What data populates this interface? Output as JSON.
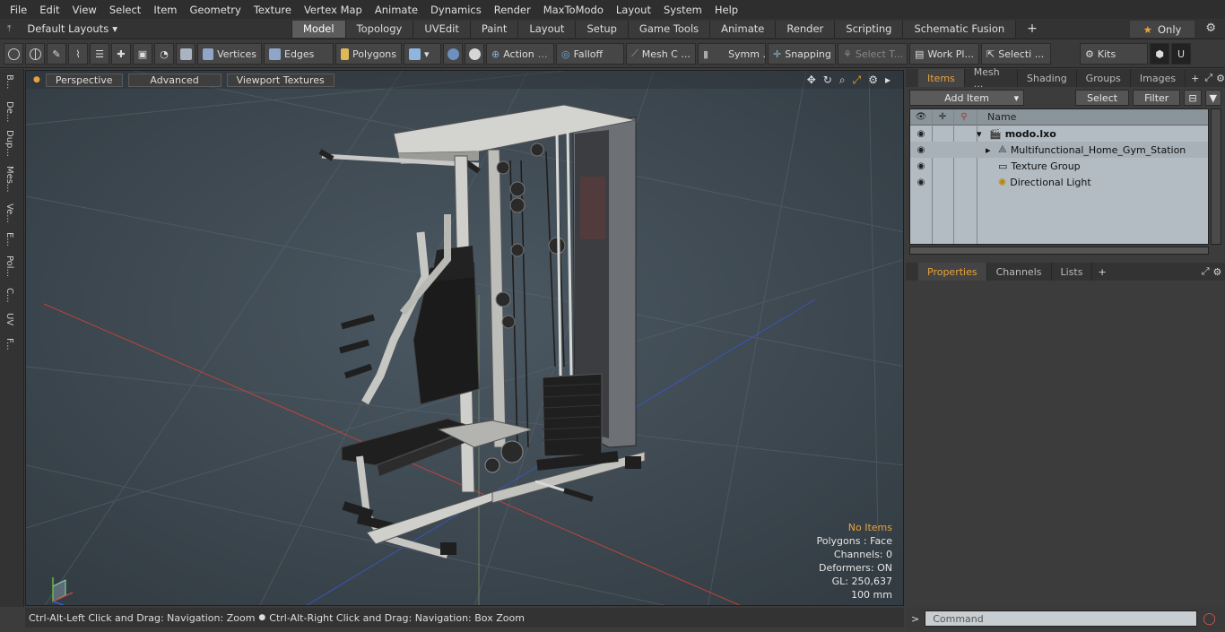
{
  "menu": [
    "File",
    "Edit",
    "View",
    "Select",
    "Item",
    "Geometry",
    "Texture",
    "Vertex Map",
    "Animate",
    "Dynamics",
    "Render",
    "MaxToModo",
    "Layout",
    "System",
    "Help"
  ],
  "layouts_label": "Default Layouts",
  "tabs": [
    "Model",
    "Topology",
    "UVEdit",
    "Paint",
    "Layout",
    "Setup",
    "Game Tools",
    "Animate",
    "Render",
    "Scripting",
    "Schematic Fusion"
  ],
  "only_label": "Only",
  "toolbar": {
    "vertices": "Vertices",
    "edges": "Edges",
    "polygons": "Polygons",
    "action": "Action",
    "falloff": "Falloff",
    "mesh": "Mesh C ...",
    "symm": "Symm ...",
    "snapping": "Snapping",
    "select_t": "Select T...",
    "work_pl": "Work Pl...",
    "selecti": "Selecti ...",
    "kits": "Kits"
  },
  "left_tabs": [
    "B...",
    "De...",
    "Dup...",
    "Mes...",
    "Ve...",
    "E...",
    "Pol...",
    "C...",
    "UV",
    "F..."
  ],
  "viewport": {
    "perspective": "Perspective",
    "advanced": "Advanced",
    "textures": "Viewport Textures",
    "stats": {
      "no_items": "No Items",
      "polygons": "Polygons : Face",
      "channels": "Channels: 0",
      "deformers": "Deformers: ON",
      "gl": "GL: 250,637",
      "unit": "100 mm"
    }
  },
  "status_left": "Ctrl-Alt-Left Click and Drag: Navigation: Zoom",
  "status_right": "Ctrl-Alt-Right Click and Drag: Navigation: Box Zoom",
  "right": {
    "tabs": [
      "Items",
      "Mesh ...",
      "Shading",
      "Groups",
      "Images"
    ],
    "add_item": "Add Item",
    "select": "Select",
    "filter": "Filter",
    "col_name": "Name",
    "items": [
      {
        "name": "modo.lxo",
        "bold": true
      },
      {
        "name": "Multifunctional_Home_Gym_Station"
      },
      {
        "name": "Texture Group"
      },
      {
        "name": "Directional Light"
      }
    ],
    "props_tabs": [
      "Properties",
      "Channels",
      "Lists"
    ],
    "command_placeholder": "Command"
  }
}
